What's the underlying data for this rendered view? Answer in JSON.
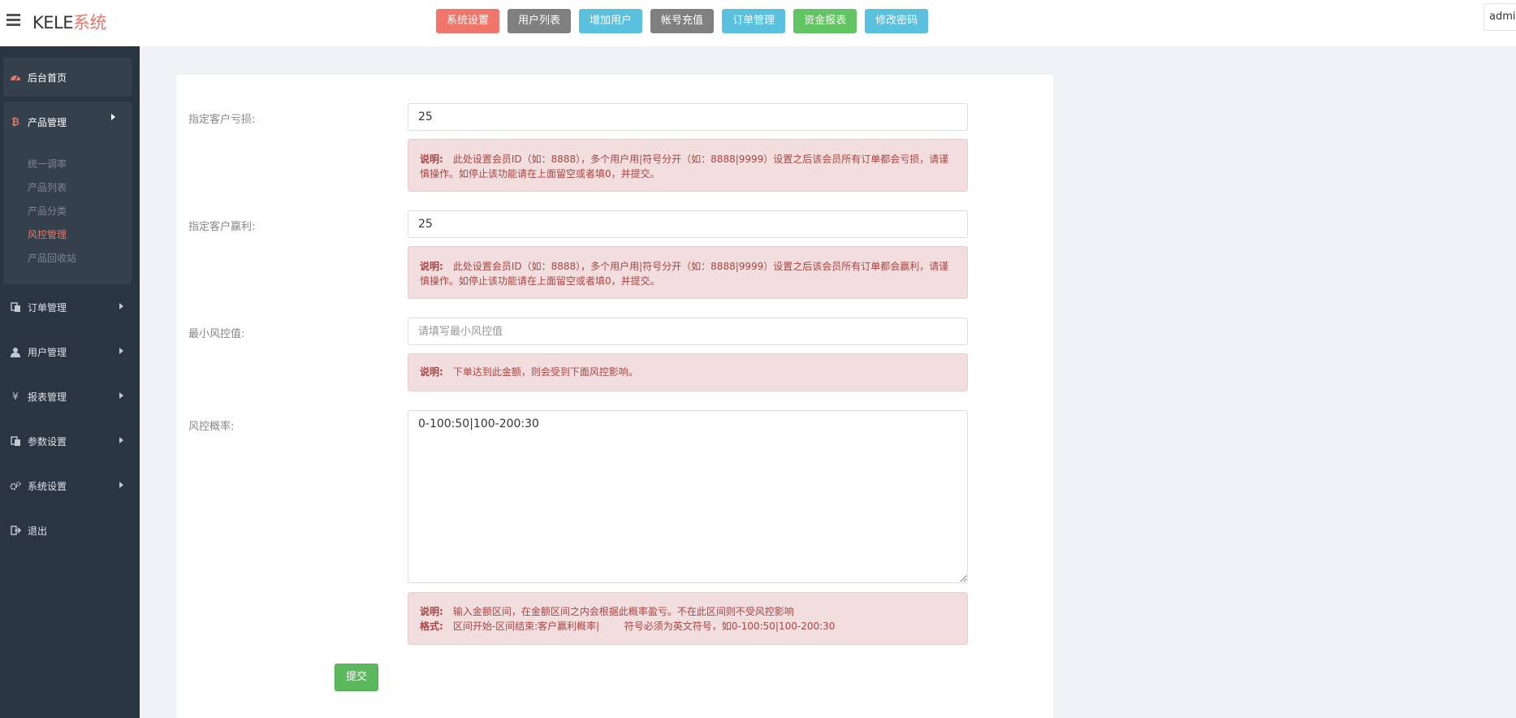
{
  "app": {
    "brand_main": "KELE",
    "brand_accent": "系统",
    "admin_label": "admin"
  },
  "topnav": [
    {
      "label": "系统设置",
      "color": "#f0756a"
    },
    {
      "label": "用户列表",
      "color": "#808080"
    },
    {
      "label": "增加用户",
      "color": "#5bc0de"
    },
    {
      "label": "帐号充值",
      "color": "#808080"
    },
    {
      "label": "订单管理",
      "color": "#5bc0de"
    },
    {
      "label": "资金报表",
      "color": "#62c462"
    },
    {
      "label": "修改密码",
      "color": "#5bc0de"
    }
  ],
  "sidebar": {
    "home": "后台首页",
    "product": "产品管理",
    "product_sub": [
      "统一调率",
      "产品列表",
      "产品分类",
      "风控管理",
      "产品回收站"
    ],
    "active_sub": "风控管理",
    "items": [
      {
        "label": "订单管理",
        "icon": "copy-icon"
      },
      {
        "label": "用户管理",
        "icon": "user-icon"
      },
      {
        "label": "报表管理",
        "icon": "yen-icon"
      },
      {
        "label": "参数设置",
        "icon": "copy-icon"
      },
      {
        "label": "系统设置",
        "icon": "gears-icon"
      },
      {
        "label": "退出",
        "icon": "sign-out-icon"
      }
    ]
  },
  "form": {
    "loss_label": "指定客户亏损:",
    "loss_value": "25",
    "loss_note_title": "说明:",
    "loss_note_text": "此处设置会员ID（如：8888），多个用户用|符号分开（如：8888|9999）设置之后该会员所有订单都会亏损，请谨慎操作。如停止该功能请在上面留空或者填0，并提交。",
    "win_label": "指定客户赢利:",
    "win_value": "25",
    "win_note_title": "说明:",
    "win_note_text": "此处设置会员ID（如：8888），多个用户用|符号分开（如：8888|9999）设置之后该会员所有订单都会赢利，请谨慎操作。如停止该功能请在上面留空或者填0，并提交。",
    "min_label": "最小风控值:",
    "min_placeholder": "请填写最小风控值",
    "min_note_title": "说明:",
    "min_note_text": "下单达到此金额，则会受到下面风控影响。",
    "rate_label": "风控概率:",
    "rate_value": "0-100:50|100-200:30",
    "rate_note_title1": "说明:",
    "rate_note_text1": "输入金额区间，在金额区间之内会根据此概率盈亏。不在此区间则不受风控影响",
    "rate_note_title2": "格式:",
    "rate_note_text2": "区间开始-区间结束:客户赢利概率|        符号必须为英文符号，如0-100:50|100-200:30",
    "submit": "提交"
  }
}
